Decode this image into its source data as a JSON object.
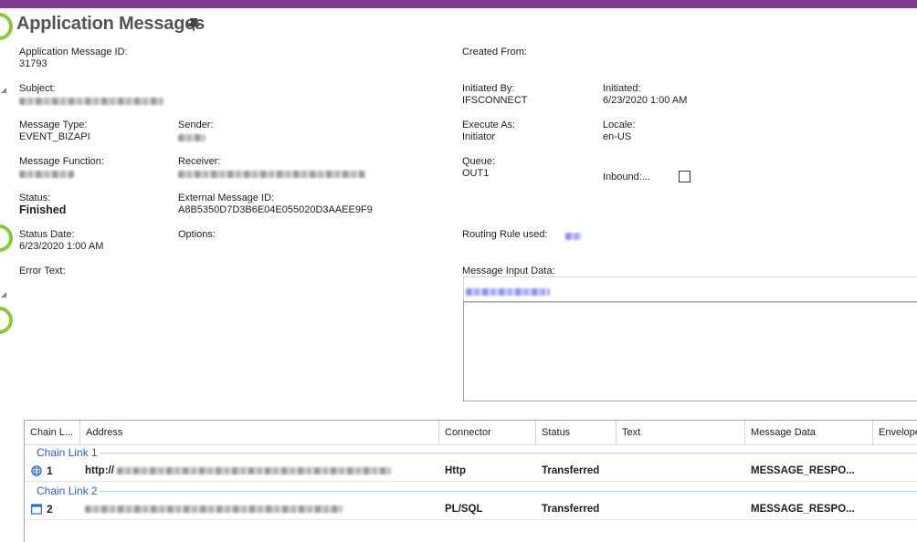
{
  "page": {
    "title": "Application Messages"
  },
  "fields": {
    "application_message_id": {
      "label": "Application Message ID:",
      "value": "31793"
    },
    "created_from": {
      "label": "Created From:",
      "value": ""
    },
    "subject": {
      "label": "Subject:"
    },
    "initiated_by": {
      "label": "Initiated By:",
      "value": "IFSCONNECT"
    },
    "initiated": {
      "label": "Initiated:",
      "value": "6/23/2020 1:00 AM"
    },
    "message_type": {
      "label": "Message Type:",
      "value": "EVENT_BIZAPI"
    },
    "sender": {
      "label": "Sender:"
    },
    "execute_as": {
      "label": "Execute As:",
      "value": "Initiator"
    },
    "locale": {
      "label": "Locale:",
      "value": "en-US"
    },
    "message_function": {
      "label": "Message Function:"
    },
    "receiver": {
      "label": "Receiver:"
    },
    "queue": {
      "label": "Queue:",
      "value": "OUT1"
    },
    "inbound": {
      "label": "Inbound:...",
      "checked": false
    },
    "status": {
      "label": "Status:",
      "value": "Finished"
    },
    "external_message_id": {
      "label": "External Message ID:",
      "value": "A8B5350D7D3B6E04E055020D3AAEE9F9"
    },
    "status_date": {
      "label": "Status Date:",
      "value": "6/23/2020 1:00 AM"
    },
    "options": {
      "label": "Options:",
      "value": ""
    },
    "routing_rule_used": {
      "label": "Routing Rule used:"
    },
    "error_text": {
      "label": "Error Text:",
      "value": ""
    },
    "message_input_data": {
      "label": "Message Input Data:"
    }
  },
  "grid": {
    "columns": [
      "Chain L...",
      "Address",
      "Connector",
      "Status",
      "Text",
      "Message Data",
      "Envelope"
    ],
    "groups": [
      {
        "label": "Chain Link 1",
        "row": {
          "num": "1",
          "icon": "globe-icon",
          "address_prefix": "http://",
          "connector": "Http",
          "status": "Transferred",
          "message_data": "MESSAGE_RESPO..."
        }
      },
      {
        "label": "Chain Link 2",
        "row": {
          "num": "2",
          "icon": "window-icon",
          "address_prefix": "",
          "connector": "PL/SQL",
          "status": "Transferred",
          "message_data": "MESSAGE_RESPO..."
        }
      }
    ]
  },
  "colors": {
    "top_bar": "#7b3a8e",
    "accent_ring": "#8dc63f",
    "group_label": "#2b5db6"
  }
}
